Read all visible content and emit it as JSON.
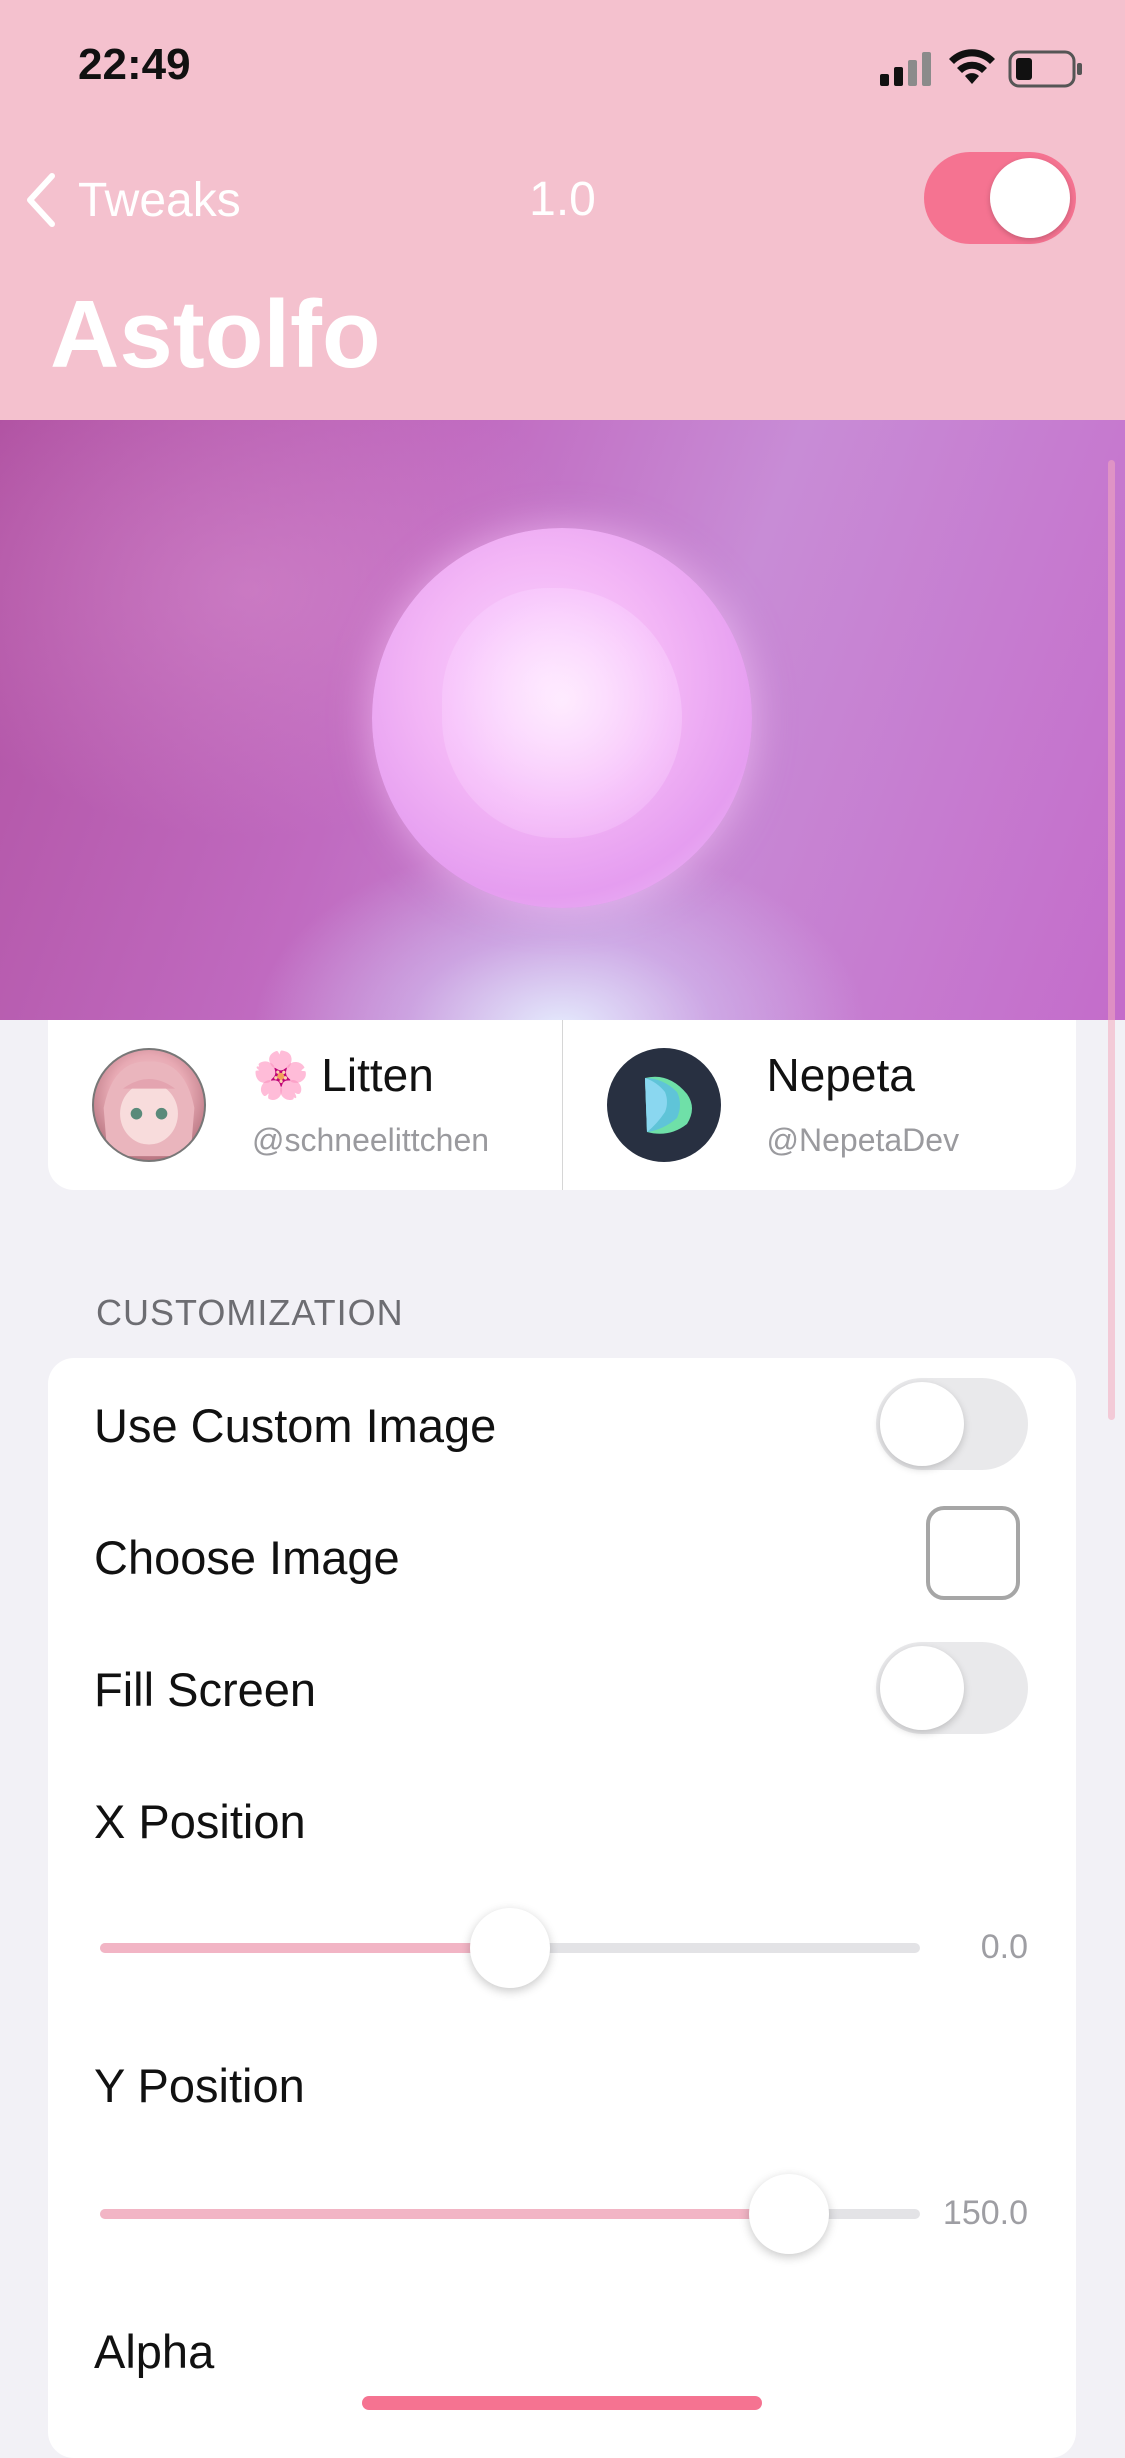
{
  "status_bar": {
    "time": "22:49"
  },
  "nav": {
    "back_label": "Tweaks",
    "version": "1.0",
    "enabled": true,
    "title": "Astolfo"
  },
  "credits": [
    {
      "name": "Litten",
      "emoji": "🌸",
      "handle": "@schneelittchen"
    },
    {
      "name": "Nepeta",
      "handle": "@NepetaDev"
    }
  ],
  "section": {
    "title": "CUSTOMIZATION"
  },
  "settings": {
    "use_custom_image": {
      "label": "Use Custom Image",
      "enabled": false
    },
    "choose_image": {
      "label": "Choose Image"
    },
    "fill_screen": {
      "label": "Fill Screen",
      "enabled": false
    },
    "x_position": {
      "label": "X Position",
      "value": "0.0",
      "fraction": 0.5
    },
    "y_position": {
      "label": "Y Position",
      "value": "150.0",
      "fraction": 0.84
    },
    "alpha": {
      "label": "Alpha"
    }
  },
  "colors": {
    "header_bg": "#f4c1ce",
    "accent": "#f57391",
    "slider_fill": "#f2b5c5"
  }
}
